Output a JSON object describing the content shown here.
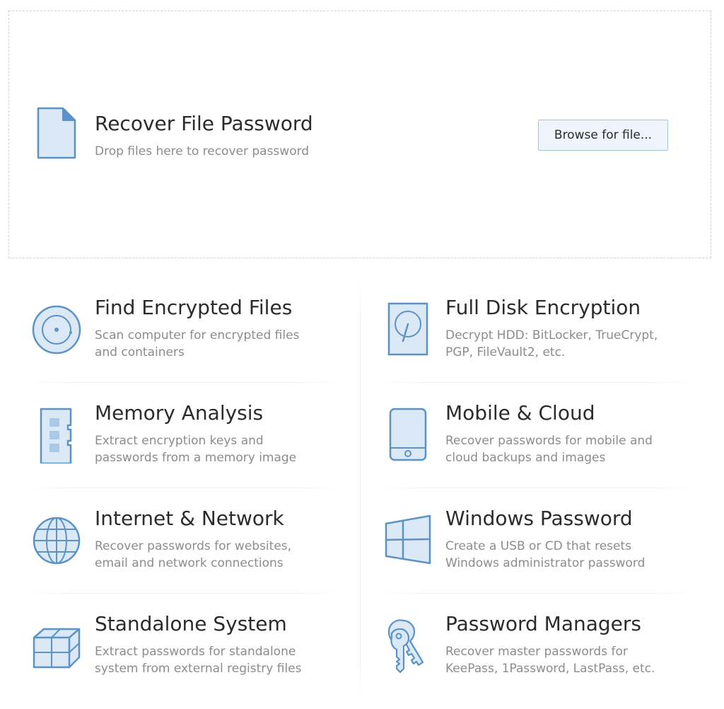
{
  "drop_zone": {
    "title": "Recover File Password",
    "subtitle": "Drop files here to recover password",
    "browse_label": "Browse for file..."
  },
  "tiles": [
    {
      "title": "Find Encrypted Files",
      "desc_line1": "Scan computer for encrypted files",
      "desc_line2": "and containers",
      "icon": "disc-icon"
    },
    {
      "title": "Full Disk Encryption",
      "desc_line1": "Decrypt HDD: BitLocker, TrueCrypt,",
      "desc_line2": "PGP, FileVault2, etc.",
      "icon": "hard-drive-icon"
    },
    {
      "title": "Memory Analysis",
      "desc_line1": "Extract encryption keys and",
      "desc_line2": "passwords from a memory image",
      "icon": "memory-chip-icon"
    },
    {
      "title": "Mobile & Cloud",
      "desc_line1": "Recover passwords for mobile and",
      "desc_line2": "cloud backups and images",
      "icon": "mobile-phone-icon"
    },
    {
      "title": "Internet & Network",
      "desc_line1": "Recover passwords for websites,",
      "desc_line2": "email and network connections",
      "icon": "globe-icon"
    },
    {
      "title": "Windows Password",
      "desc_line1": "Create a USB or CD that resets",
      "desc_line2": "Windows administrator password",
      "icon": "windows-logo-icon"
    },
    {
      "title": "Standalone System",
      "desc_line1": "Extract passwords for standalone",
      "desc_line2": "system from external registry files",
      "icon": "cubes-icon"
    },
    {
      "title": "Password Managers",
      "desc_line1": "Recover master passwords for",
      "desc_line2": "KeePass, 1Password, LastPass, etc.",
      "icon": "keys-icon"
    }
  ],
  "colors": {
    "icon_stroke": "#5b93c9",
    "icon_fill": "#dbe8f5",
    "title_text": "#2b2b2b",
    "desc_text": "#8c8c8c",
    "button_bg": "#eef4fb",
    "button_border": "#a9c4de"
  }
}
